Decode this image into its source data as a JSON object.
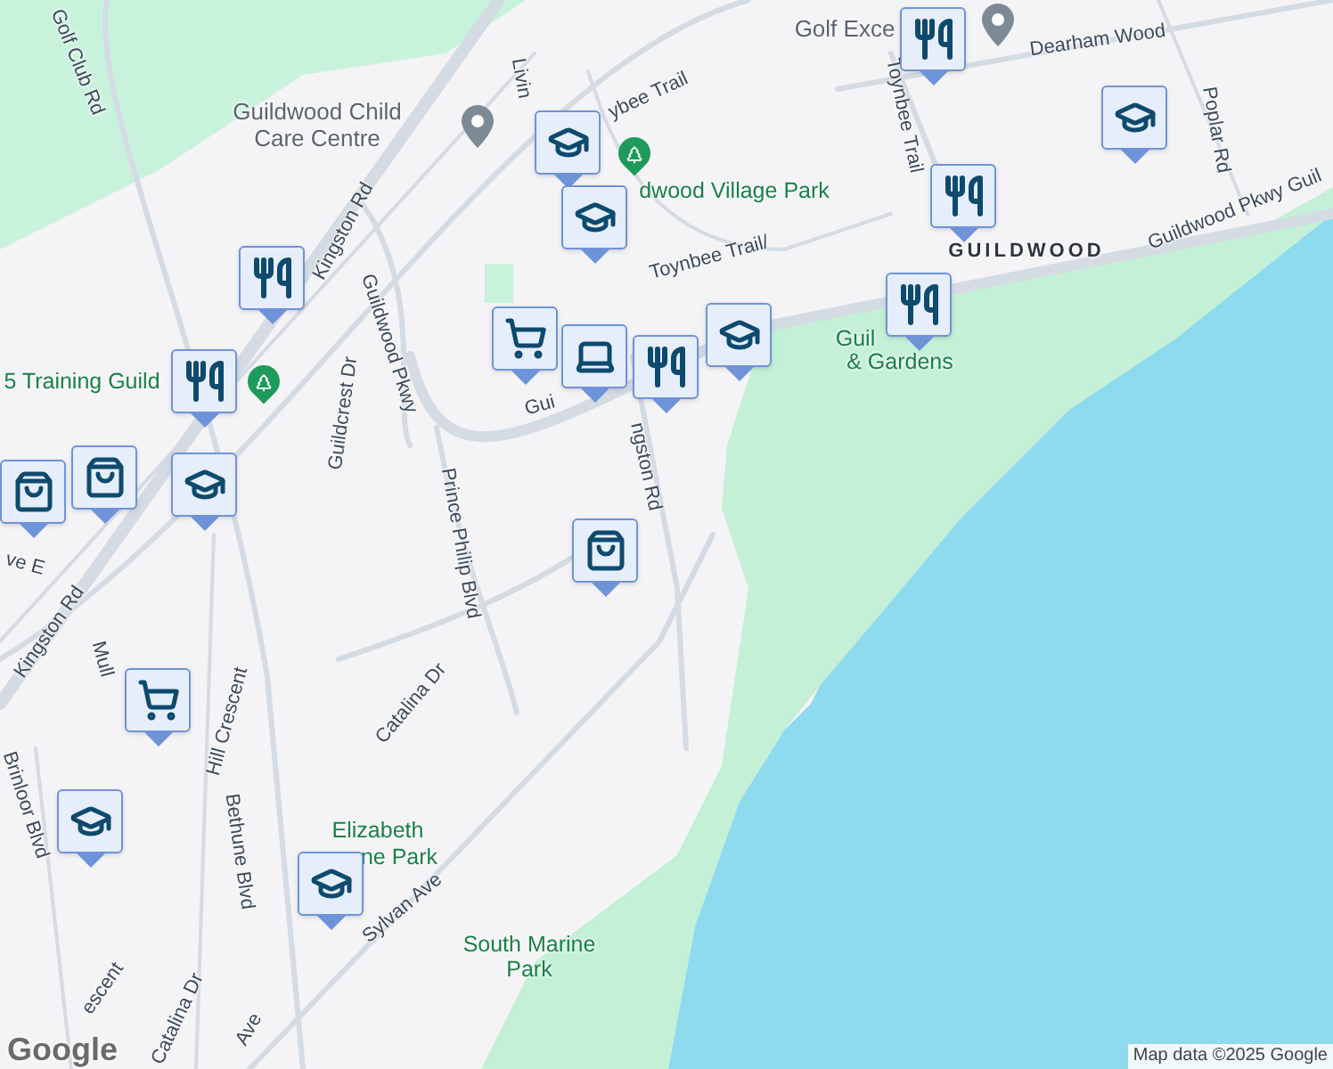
{
  "map": {
    "labels": [
      {
        "kind": "road",
        "text": "Golf Club Rd"
      },
      {
        "kind": "poi",
        "text": "Guildwood Child Care Centre"
      },
      {
        "kind": "road",
        "text": "Kingston Rd"
      },
      {
        "kind": "road",
        "text": "Guildwood Pkwy"
      },
      {
        "kind": "road",
        "text": "Guildcrest Dr"
      },
      {
        "kind": "road",
        "text": "Prince Philip Blvd"
      },
      {
        "kind": "road",
        "text": "Catalina Dr"
      },
      {
        "kind": "road",
        "text": "Hill Crescent"
      },
      {
        "kind": "road",
        "text": "Bethune Blvd"
      },
      {
        "kind": "road",
        "text": "Brinloor Blvd"
      },
      {
        "kind": "park",
        "text": "Elizabeth"
      },
      {
        "kind": "park",
        "text": "ne Park"
      },
      {
        "kind": "road",
        "text": "Sylvan Ave"
      },
      {
        "kind": "park",
        "text": "South Marine Park"
      },
      {
        "kind": "road",
        "text": "Catalina Dr"
      },
      {
        "kind": "road",
        "text": "Ave"
      },
      {
        "kind": "road",
        "text": "escent"
      },
      {
        "kind": "road",
        "text": "Mull"
      },
      {
        "kind": "road",
        "text": "Kingston Rd"
      },
      {
        "kind": "road",
        "text": "ve E"
      },
      {
        "kind": "park",
        "text": "5 Training Guild"
      },
      {
        "kind": "road",
        "text": "Livin"
      },
      {
        "kind": "road",
        "text": "ybee Trail"
      },
      {
        "kind": "park",
        "text": "dwood Village Park"
      },
      {
        "kind": "road",
        "text": "Toynbee Trail/"
      },
      {
        "kind": "road",
        "text": "Gui"
      },
      {
        "kind": "road",
        "text": "ngston Rd"
      },
      {
        "kind": "poi",
        "text": "Golf Exce"
      },
      {
        "kind": "road",
        "text": "Dearham Wood"
      },
      {
        "kind": "road",
        "text": "Toynbee Trail"
      },
      {
        "kind": "road",
        "text": "Poplar Rd"
      },
      {
        "kind": "district",
        "text": "GUILDWOOD"
      },
      {
        "kind": "road",
        "text": "Guildwood Pkwy Guil"
      },
      {
        "kind": "park",
        "text": "Guil"
      },
      {
        "kind": "park",
        "text": "& Gardens"
      }
    ],
    "pins": [
      {
        "kind": "poi"
      },
      {
        "kind": "poi"
      },
      {
        "kind": "park"
      },
      {
        "kind": "park"
      }
    ],
    "markers": [
      {
        "kind": "restaurant"
      },
      {
        "kind": "restaurant"
      },
      {
        "kind": "restaurant"
      },
      {
        "kind": "school"
      },
      {
        "kind": "school"
      },
      {
        "kind": "bag"
      },
      {
        "kind": "bag"
      },
      {
        "kind": "cart"
      },
      {
        "kind": "restaurant"
      },
      {
        "kind": "restaurant"
      },
      {
        "kind": "school"
      },
      {
        "kind": "bag"
      },
      {
        "kind": "cart"
      },
      {
        "kind": "cafe"
      },
      {
        "kind": "restaurant"
      },
      {
        "kind": "school"
      },
      {
        "kind": "school"
      },
      {
        "kind": "school"
      },
      {
        "kind": "school"
      }
    ],
    "logo": "Google",
    "attribution": "Map data ©2025 Google"
  }
}
